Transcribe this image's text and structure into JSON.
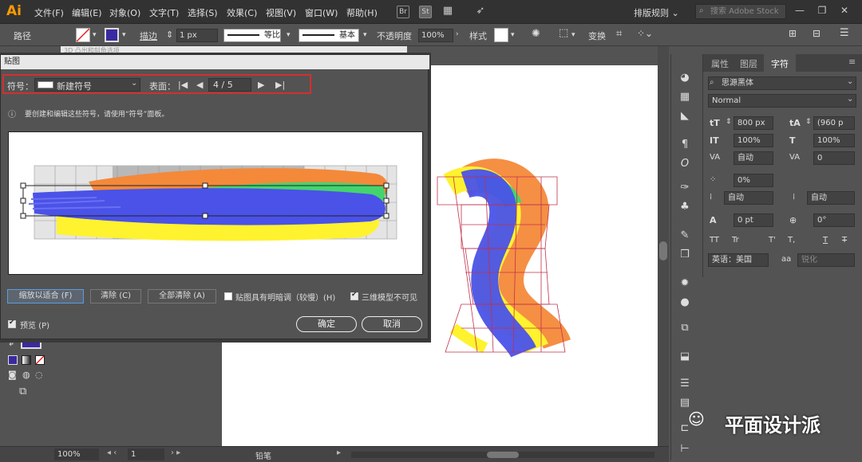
{
  "app": {
    "logo": "Ai"
  },
  "menubar": {
    "items": [
      "文件(F)",
      "编辑(E)",
      "对象(O)",
      "文字(T)",
      "选择(S)",
      "效果(C)",
      "视图(V)",
      "窗口(W)",
      "帮助(H)"
    ],
    "icons": [
      "Br",
      "St"
    ],
    "arrange_label": "排版规则",
    "search_placeholder": "搜索 Adobe Stock"
  },
  "controlbar": {
    "path_label": "路径",
    "stroke_label": "描边",
    "stroke_value": "1 px",
    "profile_label": "等比",
    "brush_label": "基本",
    "opacity_label": "不透明度",
    "opacity_value": "100%",
    "style_label": "样式",
    "transform_label": "变换"
  },
  "dialog": {
    "title": "贴图",
    "bg_doc_tab": "3D 凸出和斜角选项",
    "symbol_label": "符号",
    "symbol_value": "新建符号",
    "surface_label": "表面",
    "surface_value": "4 / 5",
    "info_text": "要创建和编辑这些符号，请使用“符号”面板。",
    "scale_to_fit": "缩放以适合 (F)",
    "clear": "清除 (C)",
    "clear_all": "全部清除 (A)",
    "shade_artwork": "贴图具有明暗调（较慢）(H)",
    "shade_checked": false,
    "invisible_geometry": "三维模型不可见",
    "invisible_checked": true,
    "preview": "预览 (P)",
    "preview_checked": true,
    "ok": "确定",
    "cancel": "取消"
  },
  "char_panel": {
    "tabs": [
      "属性",
      "图层",
      "字符"
    ],
    "active_tab": "字符",
    "font_family": "思源黑体",
    "font_style": "Normal",
    "font_size": "800 px",
    "leading": "(960 p",
    "vertical_scale": "100%",
    "horizontal_scale": "100%",
    "kerning": "自动",
    "tracking": "0",
    "tsume": "0%",
    "aki_left": "自动",
    "aki_right": "自动",
    "baseline_shift": "0 pt",
    "rotation": "0°",
    "language": "英语：美国",
    "aa_label": "aa",
    "aa_value": "锐化",
    "glyph_buttons": [
      "TT",
      "Tr",
      "T'",
      "T,",
      "T",
      "T"
    ]
  },
  "statusbar": {
    "zoom": "100%",
    "artboard_num": "1",
    "tool_name": "铅笔"
  },
  "watermark": "平面设计派",
  "colors": {
    "stroke_orange": "#f4893a",
    "stroke_green": "#44d46e",
    "stroke_blue": "#4a52e8",
    "stroke_yellow": "#fff22e",
    "mesh_red": "#c0324a",
    "highlight_red": "#d42f2f"
  }
}
